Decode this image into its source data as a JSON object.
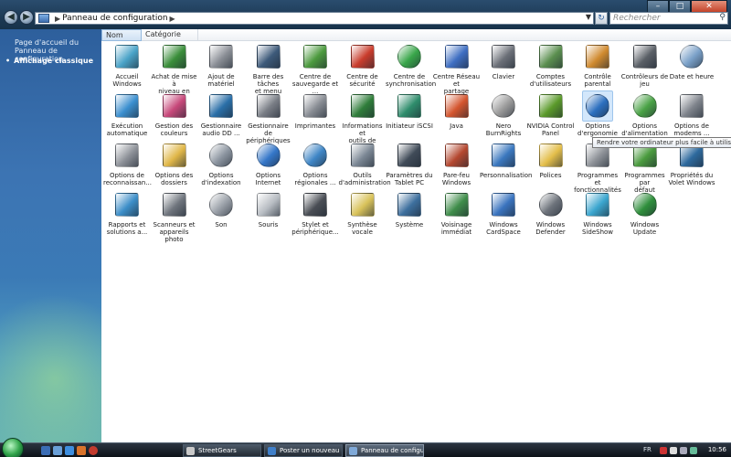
{
  "address": {
    "path": "Panneau de configuration",
    "search_placeholder": "Rechercher"
  },
  "sidebar": {
    "home_link": "Page d'accueil du Panneau de configuration",
    "active_view": "Affichage classique"
  },
  "columns": [
    "Nom",
    "Catégorie"
  ],
  "items": [
    {
      "label": "Accueil\nWindows",
      "icon": "welcome-center-icon",
      "color": "#4aa3c8"
    },
    {
      "label": "Achat de mise à\nniveau en ligne",
      "icon": "windows-flag-icon",
      "color": "#3a8e3a"
    },
    {
      "label": "Ajout de\nmatériel",
      "icon": "hardware-icon",
      "color": "#8b8f96"
    },
    {
      "label": "Barre des tâches\net menu Dém...",
      "icon": "taskbar-icon",
      "color": "#3d5a7a"
    },
    {
      "label": "Centre de\nsauvegarde et ...",
      "icon": "backup-icon",
      "color": "#4c9a3e"
    },
    {
      "label": "Centre de\nsécurité",
      "icon": "security-shield-icon",
      "color": "#c93c2c"
    },
    {
      "label": "Centre de\nsynchronisation",
      "icon": "sync-icon",
      "color": "#39a64a"
    },
    {
      "label": "Centre Réseau et\npartage",
      "icon": "network-icon",
      "color": "#3e6ec2"
    },
    {
      "label": "Clavier",
      "icon": "keyboard-icon",
      "color": "#6c7078"
    },
    {
      "label": "Comptes\nd'utilisateurs",
      "icon": "users-icon",
      "color": "#5b8f4f"
    },
    {
      "label": "Contrôle\nparental",
      "icon": "parental-icon",
      "color": "#d08a2f"
    },
    {
      "label": "Contrôleurs de\njeu",
      "icon": "gamepad-icon",
      "color": "#5a5f66"
    },
    {
      "label": "Date et heure",
      "icon": "clock-icon",
      "color": "#7aa0c8"
    },
    {
      "label": "Exécution\nautomatique",
      "icon": "autoplay-icon",
      "color": "#3b8fcf"
    },
    {
      "label": "Gestion des\ncouleurs",
      "icon": "color-management-icon",
      "color": "#c7487a"
    },
    {
      "label": "Gestionnaire\naudio DD ...",
      "icon": "audio-icon",
      "color": "#2a6fa8"
    },
    {
      "label": "Gestionnaire de\npériphériques",
      "icon": "device-manager-icon",
      "color": "#7a7e86"
    },
    {
      "label": "Imprimantes",
      "icon": "printer-icon",
      "color": "#888c93"
    },
    {
      "label": "Informations et\noutils de perf...",
      "icon": "performance-icon",
      "color": "#2f7d3a"
    },
    {
      "label": "Initiateur iSCSI",
      "icon": "iscsi-icon",
      "color": "#2f8d6c"
    },
    {
      "label": "Java",
      "icon": "java-icon",
      "color": "#d4552e"
    },
    {
      "label": "Nero BurnRights",
      "icon": "nero-icon",
      "color": "#9a9a9a"
    },
    {
      "label": "NVIDIA Control\nPanel",
      "icon": "nvidia-icon",
      "color": "#5b9a2a"
    },
    {
      "label": "Options\nd'ergonomie",
      "icon": "ease-of-access-icon",
      "color": "#2c6fbf"
    },
    {
      "label": "Options\nd'alimentation",
      "icon": "power-icon",
      "color": "#4aa246"
    },
    {
      "label": "Options de\nmodems ...",
      "icon": "modem-icon",
      "color": "#7f848c"
    },
    {
      "label": "Options de\nreconnaissan...",
      "icon": "microphone-icon",
      "color": "#8d9198"
    },
    {
      "label": "Options des\ndossiers",
      "icon": "folder-options-icon",
      "color": "#e0b748"
    },
    {
      "label": "Options\nd'indexation",
      "icon": "indexing-icon",
      "color": "#8c95a0"
    },
    {
      "label": "Options Internet",
      "icon": "internet-globe-icon",
      "color": "#3577c9"
    },
    {
      "label": "Options\nrégionales ...",
      "icon": "regional-globe-icon",
      "color": "#3f86c6"
    },
    {
      "label": "Outils\nd'administration",
      "icon": "admin-tools-icon",
      "color": "#7b8794"
    },
    {
      "label": "Paramètres du\nTablet PC",
      "icon": "tablet-icon",
      "color": "#404b58"
    },
    {
      "label": "Pare-feu\nWindows",
      "icon": "firewall-icon",
      "color": "#b4472f"
    },
    {
      "label": "Personnalisation",
      "icon": "personalization-icon",
      "color": "#3b78bf"
    },
    {
      "label": "Polices",
      "icon": "fonts-icon",
      "color": "#e3be4a"
    },
    {
      "label": "Programmes et\nfonctionnalités",
      "icon": "programs-icon",
      "color": "#8f9399"
    },
    {
      "label": "Programmes par\ndéfaut",
      "icon": "default-programs-icon",
      "color": "#4a9b3e"
    },
    {
      "label": "Propriétés du\nVolet Windows",
      "icon": "sidebar-props-icon",
      "color": "#2e6a9e"
    },
    {
      "label": "Rapports et\nsolutions a...",
      "icon": "reports-icon",
      "color": "#3c8ec8"
    },
    {
      "label": "Scanneurs et\nappareils photo",
      "icon": "scanner-icon",
      "color": "#6f757d"
    },
    {
      "label": "Son",
      "icon": "speaker-icon",
      "color": "#9aa0a8"
    },
    {
      "label": "Souris",
      "icon": "mouse-icon",
      "color": "#b7bcc2"
    },
    {
      "label": "Stylet et\npériphérique...",
      "icon": "pen-icon",
      "color": "#4a4e55"
    },
    {
      "label": "Synthèse vocale",
      "icon": "speech-icon",
      "color": "#d8c25a"
    },
    {
      "label": "Système",
      "icon": "system-icon",
      "color": "#3d6f9e"
    },
    {
      "label": "Voisinage\nimmédiat",
      "icon": "people-near-me-icon",
      "color": "#3f8d4a"
    },
    {
      "label": "Windows\nCardSpace",
      "icon": "cardspace-icon",
      "color": "#3a74bf"
    },
    {
      "label": "Windows\nDefender",
      "icon": "defender-icon",
      "color": "#6d737b"
    },
    {
      "label": "Windows\nSideShow",
      "icon": "sideshow-icon",
      "color": "#3ba6cf"
    },
    {
      "label": "Windows\nUpdate",
      "icon": "windows-update-icon",
      "color": "#2f8f3c"
    }
  ],
  "tooltip": "Rendre votre ordinateur plus facile à utiliser",
  "taskbar": {
    "tasks": [
      {
        "label": "StreetGears",
        "color": "#c9c9c9"
      },
      {
        "label": "Poster un nouveau s...",
        "color": "#3f7fc9"
      },
      {
        "label": "Panneau de configu...",
        "color": "#7fa9d8"
      }
    ],
    "language": "FR",
    "time": "10:56"
  }
}
